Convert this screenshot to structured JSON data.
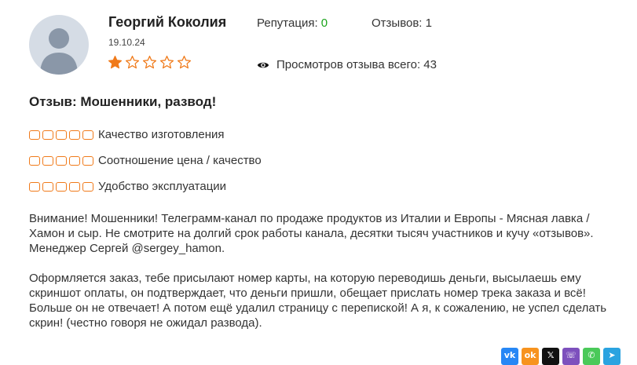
{
  "review": {
    "author": "Георгий Коколия",
    "date": "19.10.24",
    "rating": 1,
    "rating_max": 5,
    "reputation_label": "Репутация:",
    "reputation_value": "0",
    "reviews_label": "Отзывов:",
    "reviews_value": "1",
    "views_text": "Просмотров отзыва всего: 43",
    "title": "Отзыв: Мошенники, развод!",
    "criteria": [
      {
        "label": "Качество изготовления",
        "score": 0
      },
      {
        "label": "Соотношение цена / качество",
        "score": 0
      },
      {
        "label": "Удобство эксплуатации",
        "score": 0
      }
    ],
    "body": [
      "Внимание! Мошенники! Телеграмм-канал по продаже продуктов из Италии и Европы - Мясная лавка / Хамон и сыр. Не смотрите на долгий срок работы канала, десятки тысяч участников и кучу «отзывов». Менеджер Сергей @sergey_hamon.",
      "Оформляется заказ, тебе присылают номер карты, на которую переводишь деньги, высылаешь ему скриншот оплаты, он подтверждает, что деньги пришли, обещает прислать номер трека заказа и всё! Больше он не отвечает! А потом ещё удалил страницу с перепиской! А я, к сожалению, не успел сделать скрин! (честно говоря не ожидал развода)."
    ]
  },
  "colors": {
    "star": "#f07a1a",
    "reputation": "#1aa31a",
    "criterion_box": "#f07a1a"
  },
  "share": [
    {
      "name": "vk-share-button",
      "icon": "vk-icon",
      "glyph": "vk",
      "color": "#2787f5"
    },
    {
      "name": "ok-share-button",
      "icon": "ok-icon",
      "glyph": "ok",
      "color": "#f7931e"
    },
    {
      "name": "x-share-button",
      "icon": "x-icon",
      "glyph": "𝕏",
      "color": "#111111"
    },
    {
      "name": "viber-share-button",
      "icon": "viber-icon",
      "glyph": "☏",
      "color": "#7d50bd"
    },
    {
      "name": "whatsapp-share-button",
      "icon": "whatsapp-icon",
      "glyph": "✆",
      "color": "#4ac959"
    },
    {
      "name": "telegram-share-button",
      "icon": "telegram-icon",
      "glyph": "➤",
      "color": "#2aa3e0"
    }
  ]
}
